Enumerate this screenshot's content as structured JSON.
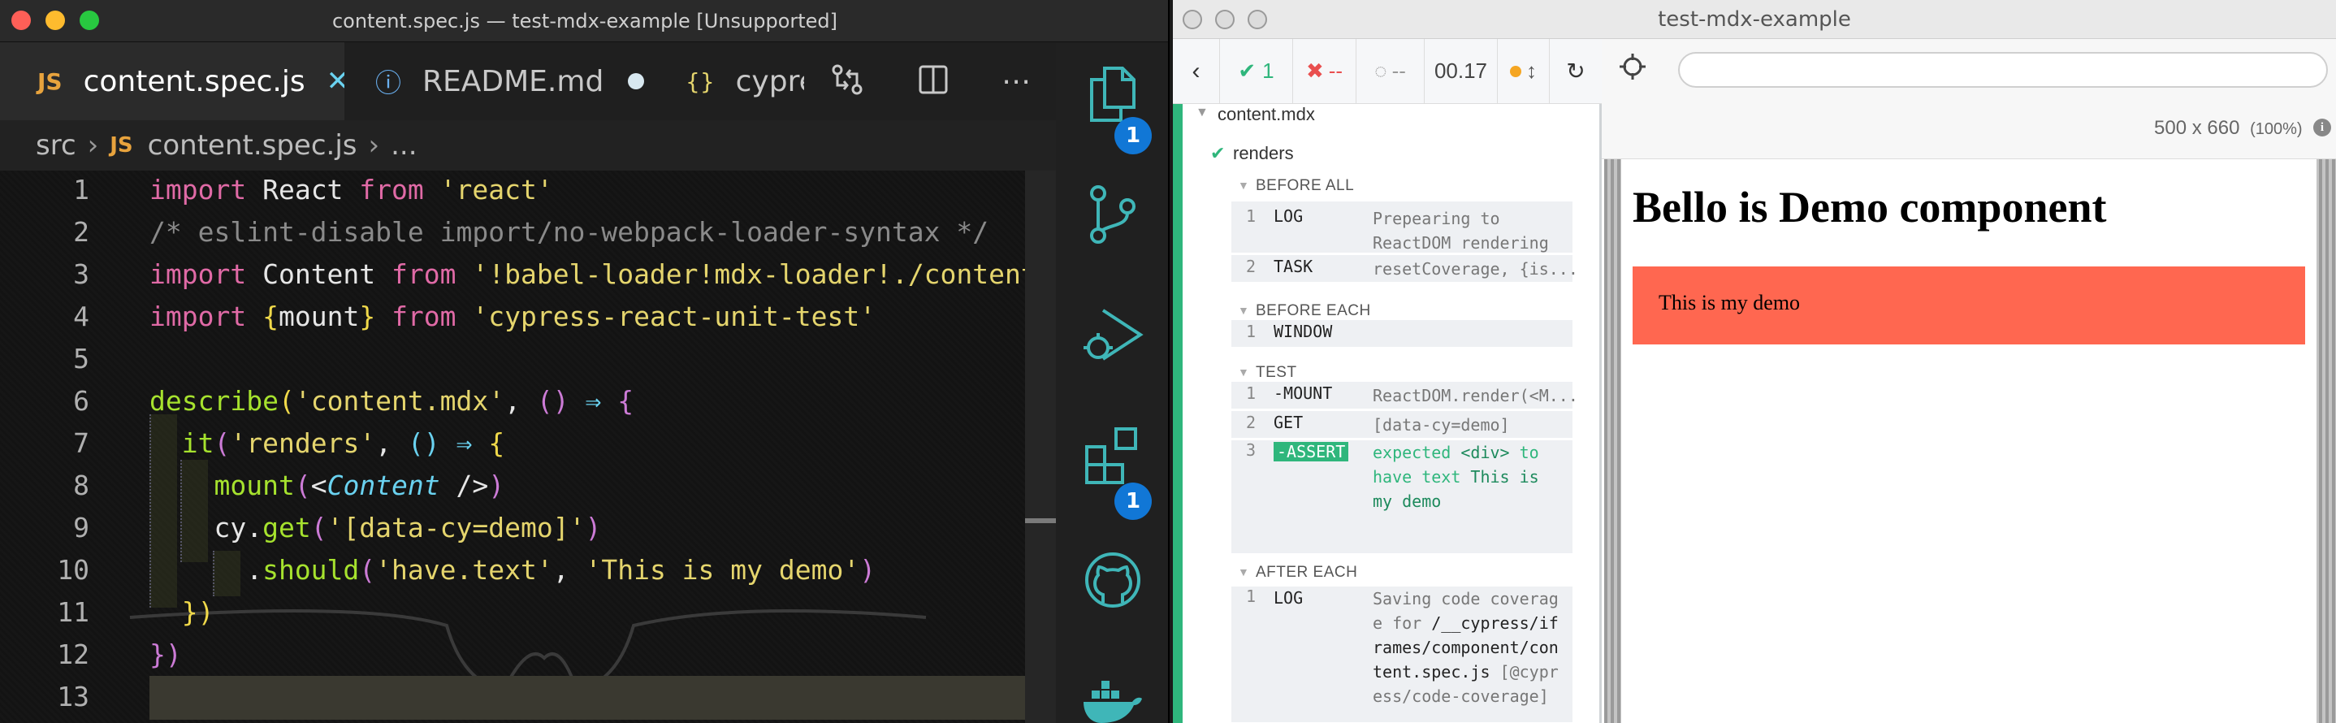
{
  "vscode": {
    "title": "content.spec.js — test-mdx-example [Unsupported]",
    "tabs": [
      {
        "icon": "JS",
        "label": "content.spec.js"
      },
      {
        "icon": "ⓘ",
        "label": "README.md"
      },
      {
        "icon": "{}",
        "label": "cypress"
      }
    ],
    "breadcrumb": {
      "folder": "src",
      "file_icon": "JS",
      "file": "content.spec.js",
      "more": "..."
    },
    "line_numbers": [
      "1",
      "2",
      "3",
      "4",
      "5",
      "6",
      "7",
      "8",
      "9",
      "10",
      "11",
      "12",
      "13"
    ],
    "activity_badges": {
      "explorer": "1",
      "extensions": "1"
    }
  },
  "cypress": {
    "title": "test-mdx-example",
    "header": {
      "passed": "1",
      "failed": "--",
      "pending": "--",
      "duration": "00.17"
    },
    "spec_name": "content.mdx",
    "test_name": "renders",
    "hooks": {
      "before_all": "BEFORE ALL",
      "before_each": "BEFORE EACH",
      "test": "TEST",
      "after_each": "AFTER EACH"
    },
    "commands": {
      "before_all": [
        {
          "num": "1",
          "name": "LOG",
          "message": "Prepearing to ReactDOM rendering"
        },
        {
          "num": "2",
          "name": "TASK",
          "message": "resetCoverage, {is..."
        }
      ],
      "before_each": [
        {
          "num": "1",
          "name": "WINDOW",
          "message": ""
        }
      ],
      "test": [
        {
          "num": "1",
          "name": "-MOUNT",
          "message": "ReactDOM.render(<M..."
        },
        {
          "num": "2",
          "name": "GET",
          "message": "[data-cy=demo]"
        },
        {
          "num": "3",
          "name": "-ASSERT",
          "message_parts": [
            "expected ",
            "<div>",
            " to have text ",
            "This is my demo"
          ]
        }
      ],
      "after_each": [
        {
          "num": "1",
          "name": "LOG",
          "message_main": "Saving code coverage for",
          "message_path": "/__cypress/iframes/component/content.spec.js",
          "message_tail": "[@cypress/code-coverage]"
        }
      ]
    },
    "viewport": {
      "size": "500 x 660",
      "zoom": "(100%)"
    },
    "app": {
      "heading": "Bello is Demo component",
      "demo_text": "This is my demo"
    },
    "colors": {
      "pass": "#2fb67c",
      "fail": "#e94f4f",
      "demo_bg": "#ff6750",
      "assert_badge": "#2fb67c"
    }
  }
}
